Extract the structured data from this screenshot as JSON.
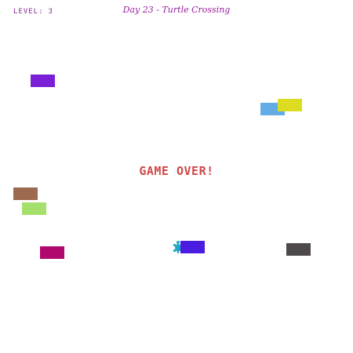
{
  "header": {
    "title": "Day 23 - Turtle Crossing",
    "title_color": "#9b1fa0",
    "level_label": "LEVEL:",
    "level_value": "3",
    "level_color": "#8a2a9a"
  },
  "status": {
    "game_over_text": "GAME OVER!",
    "color": "#d04848"
  },
  "player": {
    "icon": "turtle-icon",
    "color": "#1ea8c4"
  },
  "cars": [
    {
      "name": "car-purple",
      "color": "#7a1fd6"
    },
    {
      "name": "car-light-blue",
      "color": "#64ace6"
    },
    {
      "name": "car-yellow",
      "color": "#dcdc22"
    },
    {
      "name": "car-brown",
      "color": "#9c6a4e"
    },
    {
      "name": "car-light-green",
      "color": "#a6e06c"
    },
    {
      "name": "car-magenta",
      "color": "#b0096e"
    },
    {
      "name": "car-blue",
      "color": "#4a1ce0"
    },
    {
      "name": "car-dark-gray",
      "color": "#4e494a"
    }
  ]
}
